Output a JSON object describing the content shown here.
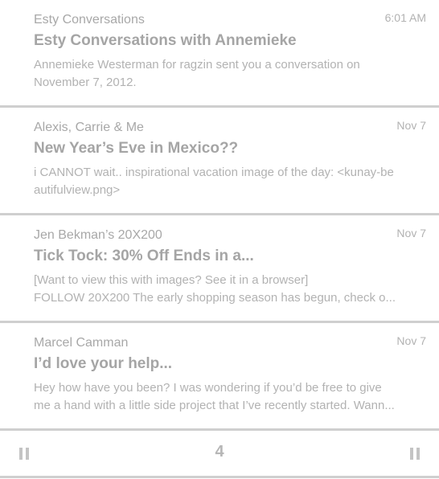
{
  "emails": [
    {
      "sender": "Esty Conversations",
      "date": "6:01 AM",
      "subject": "Esty Conversations with Annemieke",
      "preview_line1": "Annemieke Westerman for ragzin sent you a conversation on",
      "preview_line2": "November 7, 2012."
    },
    {
      "sender": "Alexis, Carrie & Me",
      "date": "Nov 7",
      "subject": "New Year’s Eve in Mexico??",
      "preview_line1": "i CANNOT wait.. inspirational vacation image of the day: <kunay-be",
      "preview_line2": "autifulview.png>"
    },
    {
      "sender": "Jen Bekman’s 20X200",
      "date": "Nov 7",
      "subject": "Tick Tock: 30% Off Ends in a...",
      "preview_line1": "[Want to view this with images? See it in a browser]",
      "preview_line2": "FOLLOW 20X200 The early shopping season has begun, check o..."
    },
    {
      "sender": "Marcel Camman",
      "date": "Nov 7",
      "subject": "I’d love your help...",
      "preview_line1": "Hey how have you been? I was wondering if you’d be free to give",
      "preview_line2": "me a hand with a little side project that I’ve recently started. Wann..."
    }
  ],
  "footer": {
    "count": "4",
    "left_icon": "pause-icon",
    "right_icon": "pause-icon"
  },
  "colors": {
    "text": "#a8a8a8",
    "divider": "#cfcfcf",
    "background": "#ffffff"
  }
}
